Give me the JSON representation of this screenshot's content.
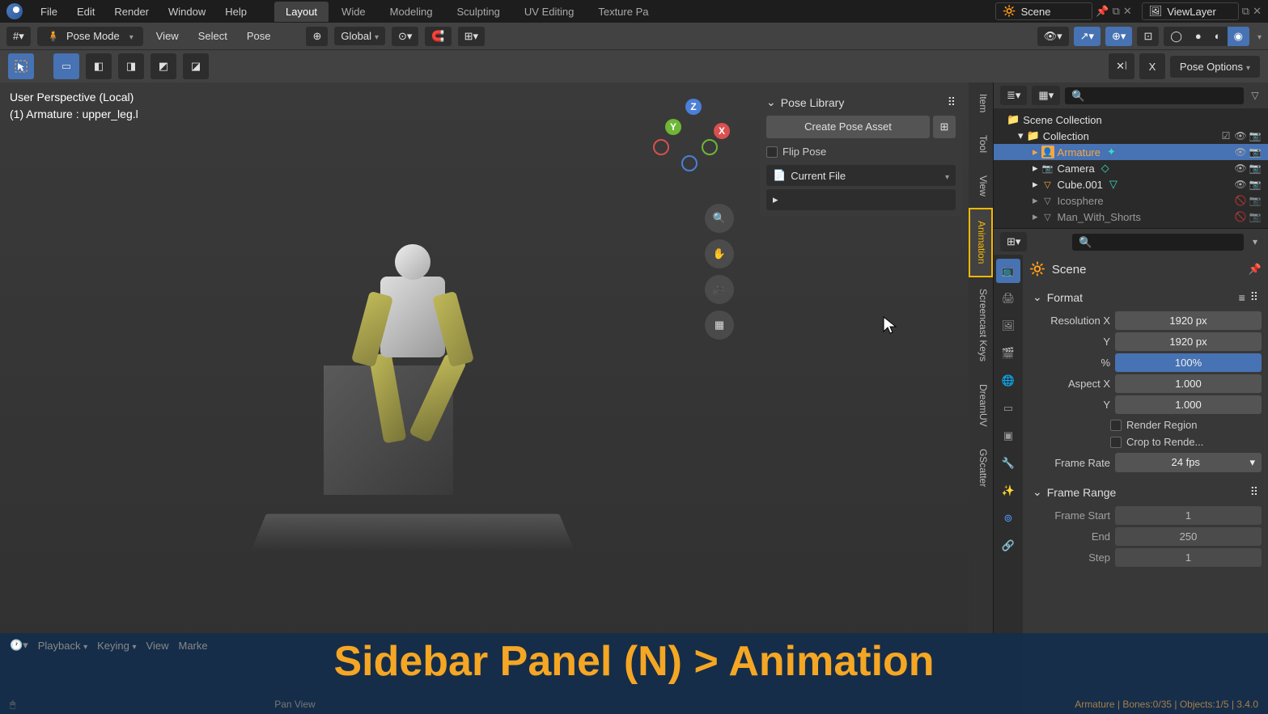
{
  "topmenu": {
    "items": [
      "File",
      "Edit",
      "Render",
      "Window",
      "Help"
    ]
  },
  "workspaces": {
    "tabs": [
      "Layout",
      "Wide",
      "Modeling",
      "Sculpting",
      "UV Editing",
      "Texture Pa"
    ],
    "active": 0
  },
  "scene": {
    "label": "Scene",
    "viewlayer": "ViewLayer"
  },
  "header": {
    "mode": "Pose Mode",
    "menus": [
      "View",
      "Select",
      "Pose"
    ],
    "orientation": "Global",
    "pose_options": "Pose Options"
  },
  "viewport": {
    "line1": "User Perspective (Local)",
    "line2": "(1) Armature : upper_leg.l"
  },
  "pose_library": {
    "title": "Pose Library",
    "create": "Create Pose Asset",
    "flip": "Flip Pose",
    "file": "Current File"
  },
  "vtabs": [
    "Item",
    "Tool",
    "View",
    "Animation",
    "Screencast Keys",
    "DreamUV",
    "GScatter"
  ],
  "outliner": {
    "root": "Scene Collection",
    "collection": "Collection",
    "items": [
      {
        "name": "Armature",
        "active": true,
        "icon": "👤",
        "color": "#f5a742"
      },
      {
        "name": "Camera",
        "icon": "📷",
        "color": "#f5a742"
      },
      {
        "name": "Cube.001",
        "icon": "▽",
        "color": "#f5a742"
      },
      {
        "name": "Icosphere",
        "icon": "▽",
        "color": "#888"
      },
      {
        "name": "Man_With_Shorts",
        "icon": "▽",
        "color": "#888"
      }
    ]
  },
  "properties": {
    "context": "Scene",
    "format": {
      "title": "Format",
      "res_x_label": "Resolution X",
      "res_x": "1920 px",
      "res_y_label": "Y",
      "res_y": "1920 px",
      "pct_label": "%",
      "pct": "100%",
      "aspect_x_label": "Aspect X",
      "aspect_x": "1.000",
      "aspect_y_label": "Y",
      "aspect_y": "1.000",
      "render_region": "Render Region",
      "crop": "Crop to Rende...",
      "frame_rate_label": "Frame Rate",
      "frame_rate": "24 fps"
    },
    "frame_range": {
      "title": "Frame Range",
      "start_label": "Frame Start",
      "start": "1",
      "end_label": "End",
      "end": "250",
      "step_label": "Step",
      "step": "1"
    }
  },
  "timeline": {
    "menus": [
      "Playback",
      "Keying",
      "View",
      "Marke"
    ]
  },
  "status": {
    "action": "Pan View",
    "right": "Armature | Bones:0/35 | Objects:1/5 | 3.4.0"
  },
  "overlay": "Sidebar Panel (N) > Animation"
}
